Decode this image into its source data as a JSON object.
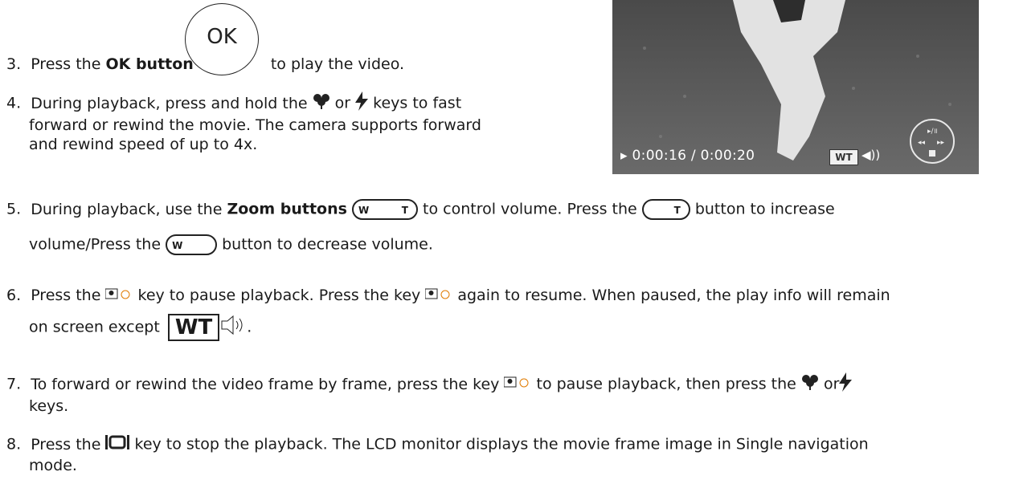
{
  "items": {
    "s3": {
      "num": "3.",
      "a": "Press the ",
      "b": "OK button",
      "c": "to play the video."
    },
    "ok_label": "OK",
    "s4": {
      "num": "4.",
      "line1a": "During playback, press and hold the ",
      "line1b": " or ",
      "line1c": " keys to fast",
      "line2": "forward or rewind the movie. The camera supports forward",
      "line3": "and rewind speed of up to 4x."
    },
    "s5": {
      "num": "5.",
      "a": "During playback, use the ",
      "b": "Zoom buttons",
      "c": " to control volume. Press the ",
      "d": " button to increase",
      "line2a": "volume/Press the ",
      "line2b": " button to decrease volume."
    },
    "s6": {
      "num": "6.",
      "a": "Press the ",
      "b": " key to pause playback. Press the key ",
      "c": " again to resume. When paused, the play info will remain",
      "line2a": "on screen except ",
      "wt": "WT"
    },
    "s7": {
      "num": "7.",
      "a": "To forward or rewind the video frame by frame, press the key ",
      "b": " to pause playback, then press the ",
      "c": " or",
      "line2": "keys."
    },
    "s8": {
      "num": "8.",
      "a": "Press the ",
      "b": " key to stop the playback. The LCD monitor displays the movie frame image in Single navigation",
      "line2": "mode."
    }
  },
  "video": {
    "timecode": "0:00:16 / 0:00:20",
    "wt": "WT"
  },
  "icons": [
    "macro-flower-icon",
    "flash-icon",
    "zoom-rocker-icon",
    "zoom-t-icon",
    "zoom-w-icon",
    "face-detect-icon",
    "volume-speaker-icon",
    "playback-icon",
    "dpad-icon"
  ]
}
